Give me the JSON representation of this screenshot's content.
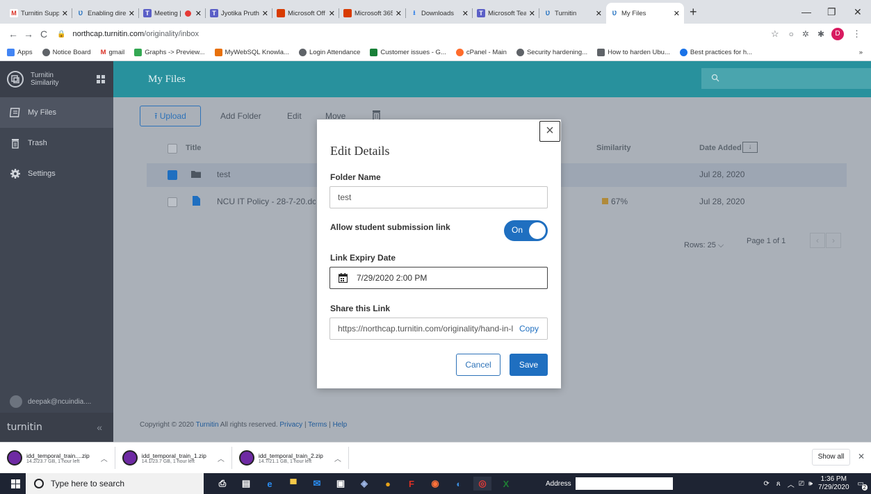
{
  "browser": {
    "tabs": [
      {
        "label": "Turnitin Supp",
        "icon": "gmail-icon",
        "color": "#d93025"
      },
      {
        "label": "Enabling direc",
        "icon": "turnitin-icon",
        "color": "#1f6fc0"
      },
      {
        "label": "Meeting |",
        "icon": "teams-icon",
        "color": "#5b5fc7"
      },
      {
        "label": "Jyotika Pruthi",
        "icon": "teams-icon",
        "color": "#5b5fc7"
      },
      {
        "label": "Microsoft Off",
        "icon": "office-icon",
        "color": "#d83b01"
      },
      {
        "label": "Microsoft 365",
        "icon": "office-icon",
        "color": "#d83b01"
      },
      {
        "label": "Downloads",
        "icon": "download-icon",
        "color": "#1a73e8"
      },
      {
        "label": "Microsoft Tea",
        "icon": "teams-icon",
        "color": "#5b5fc7"
      },
      {
        "label": "Turnitin",
        "icon": "turnitin-icon",
        "color": "#1f6fc0"
      },
      {
        "label": "My Files",
        "icon": "turnitin-icon",
        "color": "#1f6fc0"
      }
    ],
    "url_host": "northcap.turnitin.com",
    "url_path": "/originality/inbox",
    "profile_initial": "D",
    "bookmarks": [
      {
        "label": "Apps",
        "color": "#ea4335"
      },
      {
        "label": "Notice Board",
        "color": "#5f6368"
      },
      {
        "label": "gmail",
        "color": "#d93025"
      },
      {
        "label": "Graphs -> Preview...",
        "color": "#34a853"
      },
      {
        "label": "MyWebSQL Knowla...",
        "color": "#e8710a"
      },
      {
        "label": "Login Attendance",
        "color": "#5f6368"
      },
      {
        "label": "Customer issues - G...",
        "color": "#188038"
      },
      {
        "label": "cPanel - Main",
        "color": "#ff6c2c"
      },
      {
        "label": "Security hardening...",
        "color": "#5f6368"
      },
      {
        "label": "How to harden Ubu...",
        "color": "#5f6368"
      },
      {
        "label": "Best practices for h...",
        "color": "#1a73e8"
      }
    ],
    "bookmarks_more": "»"
  },
  "sidebar": {
    "brand_line1": "Turnitin",
    "brand_line2": "Similarity",
    "items": [
      {
        "label": "My Files",
        "icon": "files-icon",
        "active": true
      },
      {
        "label": "Trash",
        "icon": "trash-icon",
        "active": false
      },
      {
        "label": "Settings",
        "icon": "gear-icon",
        "active": false
      }
    ],
    "user": "deepak@ncuindia....",
    "footer_logo": "turnitin",
    "collapse": "«"
  },
  "header": {
    "title": "My Files"
  },
  "toolbar": {
    "upload": "Upload",
    "add_folder": "Add Folder",
    "edit": "Edit",
    "move": "Move"
  },
  "table": {
    "columns": {
      "title": "Title",
      "similarity": "Similarity",
      "date_added": "Date Added"
    },
    "rows": [
      {
        "title": "test",
        "type": "folder",
        "similarity": "",
        "date": "Jul 28, 2020",
        "selected": true
      },
      {
        "title": "NCU IT Policy - 28-7-20.dc",
        "type": "document",
        "similarity": "67%",
        "date": "Jul 28, 2020",
        "selected": false
      }
    ],
    "rows_per_page": "Rows: 25",
    "page_label": "Page 1 of 1"
  },
  "footer": {
    "copyright_prefix": "Copyright © 2020",
    "brand_link": "Turnitin",
    "copyright_suffix": "All rights reserved.",
    "links": [
      "Privacy",
      "Terms",
      "Help"
    ]
  },
  "modal": {
    "title": "Edit Details",
    "folder_name_label": "Folder Name",
    "folder_name_value": "test",
    "allow_label": "Allow student submission link",
    "toggle_state": "On",
    "expiry_label": "Link Expiry Date",
    "expiry_value": "7/29/2020 2:00 PM",
    "share_label": "Share this Link",
    "share_value": "https://northcap.turnitin.com/originality/hand-in-l",
    "copy": "Copy",
    "cancel": "Cancel",
    "save": "Save"
  },
  "downloads": {
    "items": [
      {
        "name": "idd_temporal_train....zip",
        "size": "14.2/23.7 GB, 1 hour left"
      },
      {
        "name": "idd_temporal_train_1.zip",
        "size": "14.1/23.7 GB, 1 hour left"
      },
      {
        "name": "idd_temporal_train_2.zip",
        "size": "14.7/21.1 GB, 1 hour left"
      }
    ],
    "show_all": "Show all"
  },
  "taskbar": {
    "search_placeholder": "Type here to search",
    "address_label": "Address",
    "time": "1:36 PM",
    "date": "7/29/2020",
    "notif_count": "2"
  },
  "colors": {
    "teal": "#28919d",
    "sidebar": "#404652",
    "primary": "#1f6fc0"
  }
}
